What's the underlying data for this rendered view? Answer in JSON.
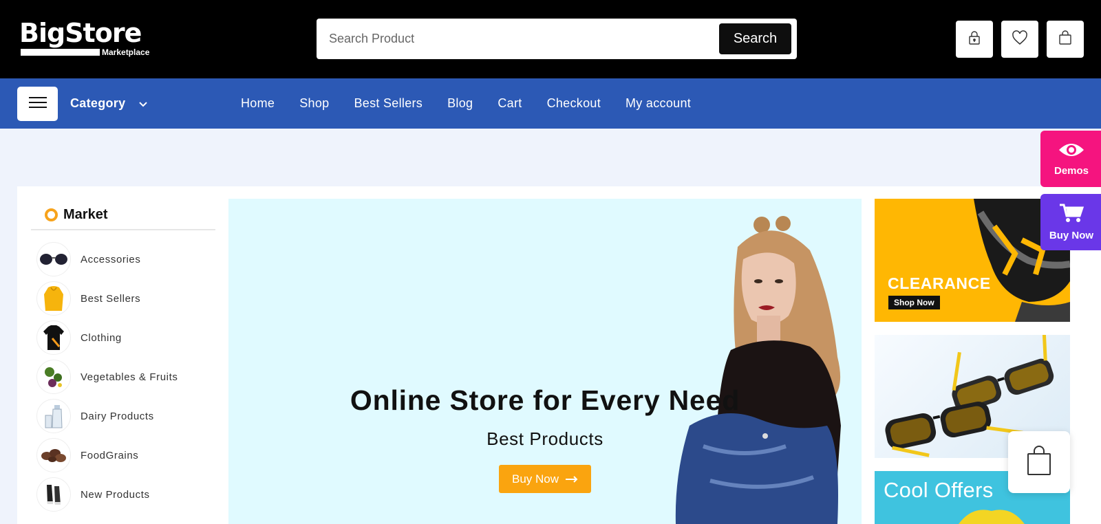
{
  "header": {
    "logo_text": "BigStore",
    "logo_sub": "Marketplace",
    "search_placeholder": "Search Product",
    "search_button": "Search",
    "icons": [
      "lock-icon",
      "heart-icon",
      "shopping-bag-icon"
    ]
  },
  "nav": {
    "category_label": "Category",
    "items": [
      {
        "label": "Home"
      },
      {
        "label": "Shop"
      },
      {
        "label": "Best Sellers"
      },
      {
        "label": "Blog"
      },
      {
        "label": "Cart"
      },
      {
        "label": "Checkout"
      },
      {
        "label": "My account"
      }
    ]
  },
  "sidebar": {
    "title": "Market",
    "items": [
      {
        "label": "Accessories",
        "icon": "sunglasses-icon"
      },
      {
        "label": "Best Sellers",
        "icon": "hoodie-icon"
      },
      {
        "label": "Clothing",
        "icon": "polo-shirt-icon"
      },
      {
        "label": "Vegetables & Fruits",
        "icon": "vegetables-icon"
      },
      {
        "label": "Dairy Products",
        "icon": "milk-bottle-icon"
      },
      {
        "label": "FoodGrains",
        "icon": "grains-icon"
      },
      {
        "label": "New Products",
        "icon": "sneakers-icon"
      }
    ]
  },
  "hero": {
    "title": "Online Store for Every Need",
    "subtitle": "Best Products",
    "button": "Buy Now"
  },
  "banners": {
    "clearance_title": "CLEARANCE",
    "clearance_cta": "Shop Now",
    "cool_offers": "Cool Offers"
  },
  "floating": {
    "demos": "Demos",
    "buy_now": "Buy Now"
  },
  "colors": {
    "header_bg": "#000000",
    "nav_bg": "#2c59b5",
    "accent_orange": "#faa40f",
    "demos_pink": "#f5147f",
    "buy_purple": "#6a37e8",
    "hero_bg": "#e0faff"
  }
}
